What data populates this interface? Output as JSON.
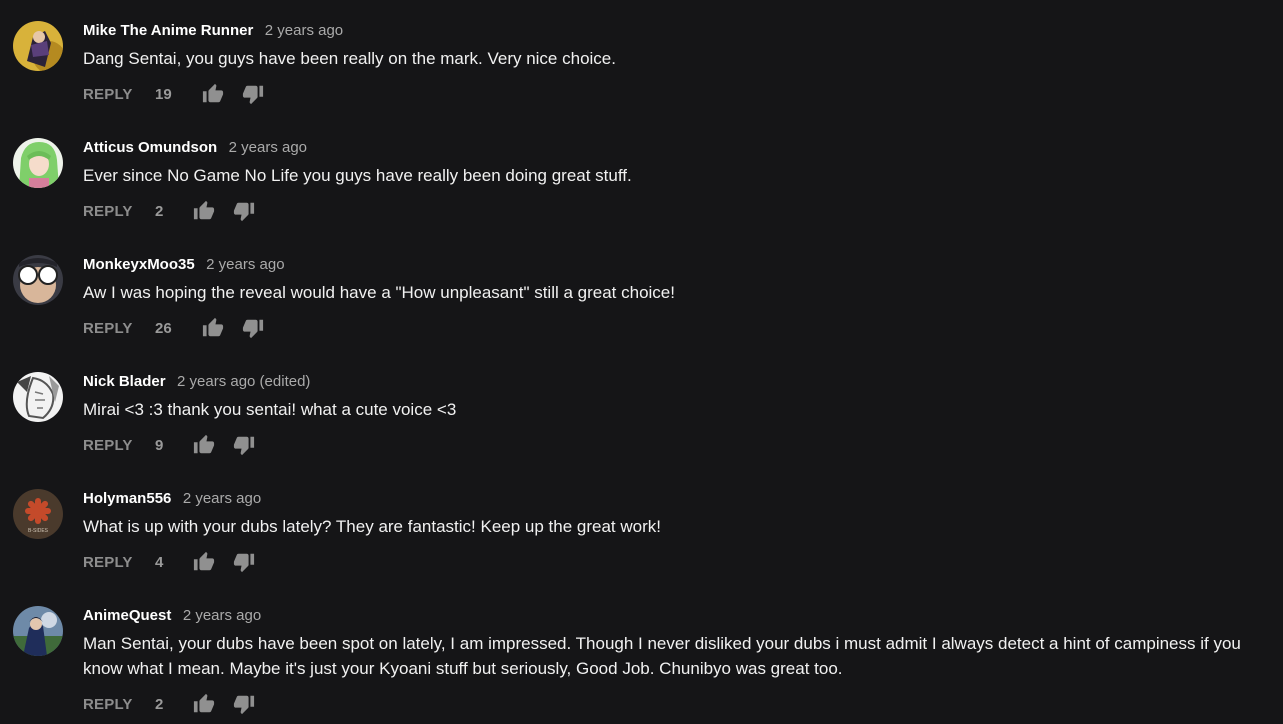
{
  "comments": [
    {
      "author": "Mike The Anime Runner",
      "time": "2 years ago",
      "text": "Dang Sentai, you guys have been really on the mark. Very nice choice.",
      "reply_label": "REPLY",
      "likes": "19",
      "avatar": "avatar-character-purple-on-yellow"
    },
    {
      "author": "Atticus Omundson",
      "time": "2 years ago",
      "text": "Ever since No Game No Life you guys have really been doing great stuff.",
      "reply_label": "REPLY",
      "likes": "2",
      "avatar": "avatar-green-hair-character"
    },
    {
      "author": "MonkeyxMoo35",
      "time": "2 years ago",
      "text": "Aw I was hoping the reveal would have a \"How unpleasant\" still a great choice!",
      "reply_label": "REPLY",
      "likes": "26",
      "avatar": "avatar-character-with-glasses"
    },
    {
      "author": "Nick Blader",
      "time": "2 years ago (edited)",
      "text": "Mirai <3 :3 thank you sentai! what a cute voice <3",
      "reply_label": "REPLY",
      "likes": "9",
      "avatar": "avatar-manga-sketch"
    },
    {
      "author": "Holyman556",
      "time": "2 years ago",
      "text": "What is up with your dubs lately? They are fantastic! Keep up the great work!",
      "reply_label": "REPLY",
      "likes": "4",
      "avatar": "avatar-red-asterisk-logo",
      "avatar_caption": "B-SIDES"
    },
    {
      "author": "AnimeQuest",
      "time": "2 years ago",
      "text": "Man Sentai, your dubs have been spot on lately, I am impressed. Though I never disliked your dubs i must admit I always detect a hint of campiness if you know what I mean. Maybe it's just your Kyoani stuff but seriously, Good Job. Chunibyo was great too.",
      "reply_label": "REPLY",
      "likes": "2",
      "avatar": "avatar-blue-character-landscape"
    }
  ],
  "colors": {
    "background": "#151517",
    "author": "#ffffff",
    "timestamp": "#aaaaaa",
    "text": "#f1f1f1",
    "action": "#8d8d8d"
  },
  "icons": {
    "like": "thumbs-up-icon",
    "dislike": "thumbs-down-icon"
  }
}
